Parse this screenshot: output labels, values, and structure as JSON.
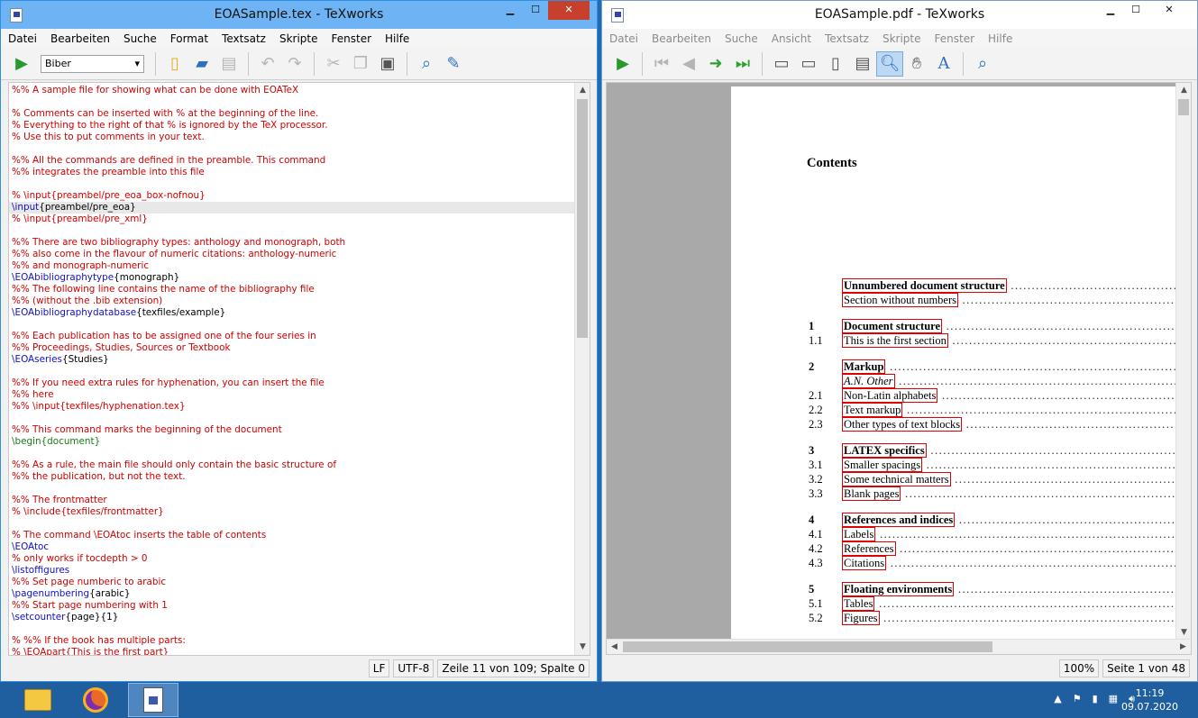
{
  "left_window": {
    "title": "EOASample.tex - TeXworks",
    "menu": [
      "Datei",
      "Bearbeiten",
      "Suche",
      "Format",
      "Textsatz",
      "Skripte",
      "Fenster",
      "Hilfe"
    ],
    "engine": "Biber",
    "status": {
      "line_ending": "LF",
      "encoding": "UTF-8",
      "position": "Zeile 11 von 109; Spalte 0"
    },
    "lines": [
      {
        "t": "%% A sample file for showing what can be done with EOATeX"
      },
      {
        "t": ""
      },
      {
        "t": "% Comments can be inserted with % at the beginning of the line."
      },
      {
        "t": "% Everything to the right of that % is ignored by the TeX processor."
      },
      {
        "t": "% Use this to put comments in your text."
      },
      {
        "t": ""
      },
      {
        "t": "%% All the commands are defined in the preamble. This command"
      },
      {
        "t": "%% integrates the preamble into this file"
      },
      {
        "t": ""
      },
      {
        "t": "% \\input{preambel/pre_eoa_box-nofnou}"
      },
      {
        "c": "\\input",
        "a": "{preambel/pre_eoa}",
        "cur": true
      },
      {
        "t": "% \\input{preambel/pre_xml}"
      },
      {
        "t": ""
      },
      {
        "t": "%% There are two bibliography types: anthology and monograph, both"
      },
      {
        "t": "%% also come in the flavour of numeric citations: anthology-numeric"
      },
      {
        "t": "%% and monograph-numeric"
      },
      {
        "c": "\\EOAbibliographytype",
        "a": "{monograph}"
      },
      {
        "t": "%% The following line contains the name of the bibliography file"
      },
      {
        "t": "%% (without the .bib extension)"
      },
      {
        "c": "\\EOAbibliographydatabase",
        "a": "{texfiles/example}"
      },
      {
        "t": ""
      },
      {
        "t": "%% Each publication has to be assigned one of the four series in"
      },
      {
        "t": "%% Proceedings, Studies, Sources or Textbook"
      },
      {
        "c": "\\EOAseries",
        "a": "{Studies}"
      },
      {
        "t": ""
      },
      {
        "t": "%% If you need extra rules for hyphenation, you can insert the file"
      },
      {
        "t": "%% here"
      },
      {
        "t": "%% \\input{texfiles/hyphenation.tex}"
      },
      {
        "t": ""
      },
      {
        "t": "%% This command marks the beginning of the document"
      },
      {
        "g": "\\begin{document}"
      },
      {
        "t": ""
      },
      {
        "t": "%% As a rule, the main file should only contain the basic structure of"
      },
      {
        "t": "%% the publication, but not the text."
      },
      {
        "t": ""
      },
      {
        "t": "%% The frontmatter"
      },
      {
        "t": "% \\include{texfiles/frontmatter}"
      },
      {
        "t": ""
      },
      {
        "t": "% The command \\EOAtoc inserts the table of contents"
      },
      {
        "c": "\\EOAtoc",
        "a": ""
      },
      {
        "t": "% only works if tocdepth > 0"
      },
      {
        "c": "\\listoffigures",
        "a": ""
      },
      {
        "t": "%% Set page numberic to arabic"
      },
      {
        "c": "\\pagenumbering",
        "a": "{arabic}"
      },
      {
        "t": "%% Start page numbering with 1"
      },
      {
        "c": "\\setcounter",
        "a": "{page}{1}"
      },
      {
        "t": ""
      },
      {
        "t": "% %% If the book has multiple parts:"
      },
      {
        "t": "% \\EOApart{This is the first part}"
      }
    ]
  },
  "right_window": {
    "title": "EOASample.pdf - TeXworks",
    "menu": [
      "Datei",
      "Bearbeiten",
      "Suche",
      "Ansicht",
      "Textsatz",
      "Skripte",
      "Fenster",
      "Hilfe"
    ],
    "status": {
      "zoom": "100%",
      "page": "Seite 1 von 48"
    },
    "pdf": {
      "heading": "Contents",
      "toc": [
        {
          "num": "",
          "label": "Unnumbered document structure",
          "bold": true
        },
        {
          "num": "",
          "label": "Section without numbers"
        },
        {
          "num": "1",
          "label": "Document structure",
          "bold": true
        },
        {
          "num": "1.1",
          "label": "This is the first section"
        },
        {
          "num": "2",
          "label": "Markup",
          "bold": true
        },
        {
          "num": "",
          "label": "A.N. Other",
          "italic": true
        },
        {
          "num": "2.1",
          "label": "Non-Latin alphabets"
        },
        {
          "num": "2.2",
          "label": "Text markup"
        },
        {
          "num": "2.3",
          "label": "Other types of text blocks"
        },
        {
          "num": "3",
          "label": "LATEX specifics",
          "bold": true
        },
        {
          "num": "3.1",
          "label": "Smaller spacings"
        },
        {
          "num": "3.2",
          "label": "Some technical matters"
        },
        {
          "num": "3.3",
          "label": "Blank pages"
        },
        {
          "num": "4",
          "label": "References and indices",
          "bold": true
        },
        {
          "num": "4.1",
          "label": "Labels"
        },
        {
          "num": "4.2",
          "label": "References"
        },
        {
          "num": "4.3",
          "label": "Citations"
        },
        {
          "num": "5",
          "label": "Floating environments",
          "bold": true
        },
        {
          "num": "5.1",
          "label": "Tables"
        },
        {
          "num": "5.2",
          "label": "Figures"
        }
      ]
    }
  },
  "taskbar": {
    "time": "11:19",
    "date": "09.07.2020"
  }
}
